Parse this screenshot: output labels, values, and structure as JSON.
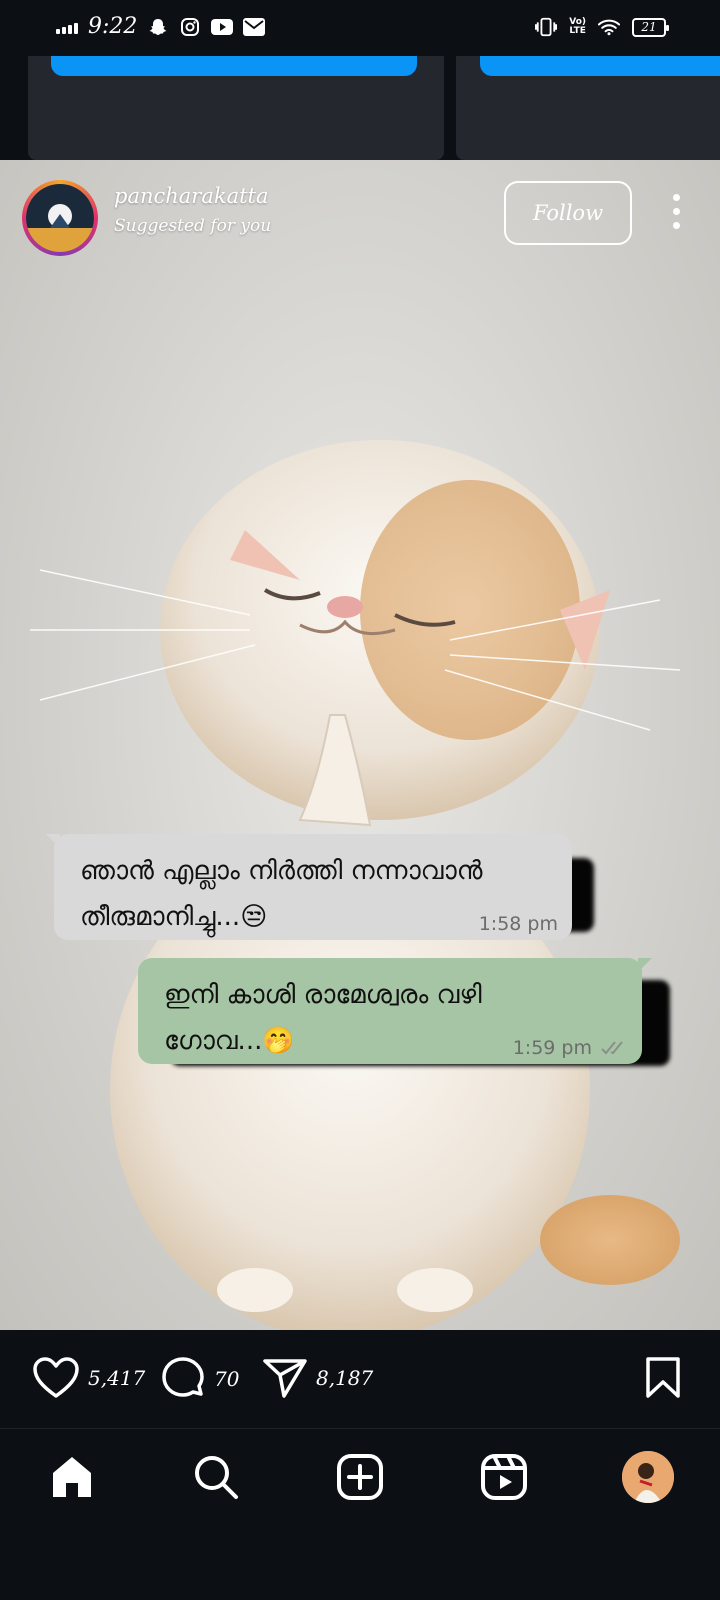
{
  "status_bar": {
    "time": "9:22",
    "battery": "21",
    "network": "LTE",
    "icons_left": [
      "signal-icon",
      "snapchat-icon",
      "instagram-icon",
      "youtube-icon",
      "mail-icon"
    ],
    "icons_right": [
      "vibrate-icon",
      "volte-icon",
      "wifi-icon",
      "battery-icon"
    ]
  },
  "post": {
    "username": "pancharakatta",
    "subtitle": "Suggested for you",
    "follow_label": "Follow",
    "messages": [
      {
        "line1": "ഞാൻ എല്ലാം നിർത്തി നന്നാവാൻ",
        "line2": "തീരുമാനിച്ചു...😒",
        "time": "1:58 pm",
        "side": "received"
      },
      {
        "line1": "ഇനി കാശി രാമേശ്വരം വഴി",
        "line2": "ഗോവ...🤭",
        "time": "1:59 pm",
        "side": "sent"
      }
    ]
  },
  "actions": {
    "likes": "5,417",
    "comments": "70",
    "shares": "8,187"
  },
  "nav": {
    "items": [
      "home-icon",
      "search-icon",
      "create-icon",
      "reels-icon",
      "profile-avatar"
    ]
  },
  "colors": {
    "background": "#0c0f14",
    "accent_blue": "#0a95f6",
    "received_bubble": "#d9d9d9",
    "sent_bubble": "#a6c5a4"
  }
}
